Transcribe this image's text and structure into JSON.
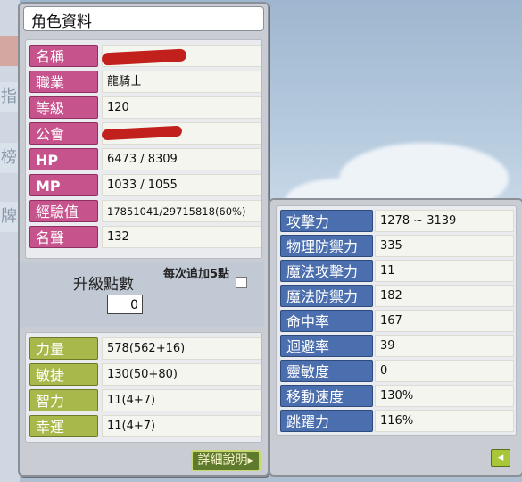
{
  "window_title": "角色資料",
  "info_rows": [
    {
      "label": "名稱",
      "value": ""
    },
    {
      "label": "職業",
      "value": "龍騎士"
    },
    {
      "label": "等級",
      "value": "120"
    },
    {
      "label": "公會",
      "value": ""
    },
    {
      "label": "HP",
      "value": "6473 / 8309"
    },
    {
      "label": "MP",
      "value": "1033 / 1055"
    },
    {
      "label": "經驗值",
      "value": "17851041/29715818(60%)"
    },
    {
      "label": "名聲",
      "value": "132"
    }
  ],
  "ability_points": {
    "label": "升級點數",
    "value": "0",
    "auto_label": "每次追加5點",
    "auto_checked": false
  },
  "stats": [
    {
      "label": "力量",
      "value": "578(562+16)"
    },
    {
      "label": "敏捷",
      "value": "130(50+80)"
    },
    {
      "label": "智力",
      "value": "11(4+7)"
    },
    {
      "label": "幸運",
      "value": "11(4+7)"
    }
  ],
  "detail_button": "詳細說明▸",
  "detail_rows": [
    {
      "label": "攻擊力",
      "value": "1278 ~ 3139"
    },
    {
      "label": "物理防禦力",
      "value": "335"
    },
    {
      "label": "魔法攻擊力",
      "value": "11"
    },
    {
      "label": "魔法防禦力",
      "value": "182"
    },
    {
      "label": "命中率",
      "value": "167"
    },
    {
      "label": "迴避率",
      "value": "39"
    },
    {
      "label": "靈敏度",
      "value": "0"
    },
    {
      "label": "移動速度",
      "value": "130%"
    },
    {
      "label": "跳躍力",
      "value": "116%"
    }
  ],
  "back_icon": "arrow-left-icon"
}
